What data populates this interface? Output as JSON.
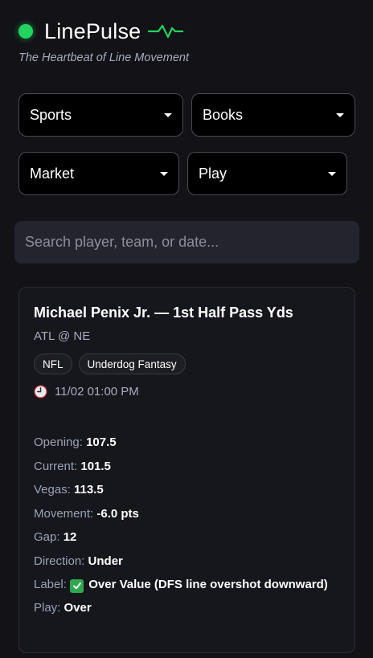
{
  "header": {
    "title": "LinePulse",
    "tagline": "The Heartbeat of Line Movement",
    "accent_color": "#22d55e",
    "logo_icon": "pulse-icon"
  },
  "filters": {
    "sports": "Sports",
    "books": "Books",
    "market": "Market",
    "play": "Play"
  },
  "search": {
    "placeholder": "Search player, team, or date..."
  },
  "card": {
    "title": "Michael Penix Jr. — 1st Half Pass Yds",
    "matchup": "ATL @ NE",
    "tags": [
      "NFL",
      "Underdog Fantasy"
    ],
    "time": "11/02 01:00 PM",
    "time_icon": "clock-icon",
    "stats": {
      "opening_label": "Opening:",
      "opening_value": "107.5",
      "current_label": "Current:",
      "current_value": "101.5",
      "vegas_label": "Vegas:",
      "vegas_value": "113.5",
      "movement_label": "Movement:",
      "movement_value": "-6.0 pts",
      "gap_label": "Gap:",
      "gap_value": "12",
      "direction_label": "Direction:",
      "direction_value": "Under",
      "label_label": "Label:",
      "label_value": "Over Value (DFS line overshot downward)",
      "play_label": "Play:",
      "play_value": "Over"
    }
  }
}
